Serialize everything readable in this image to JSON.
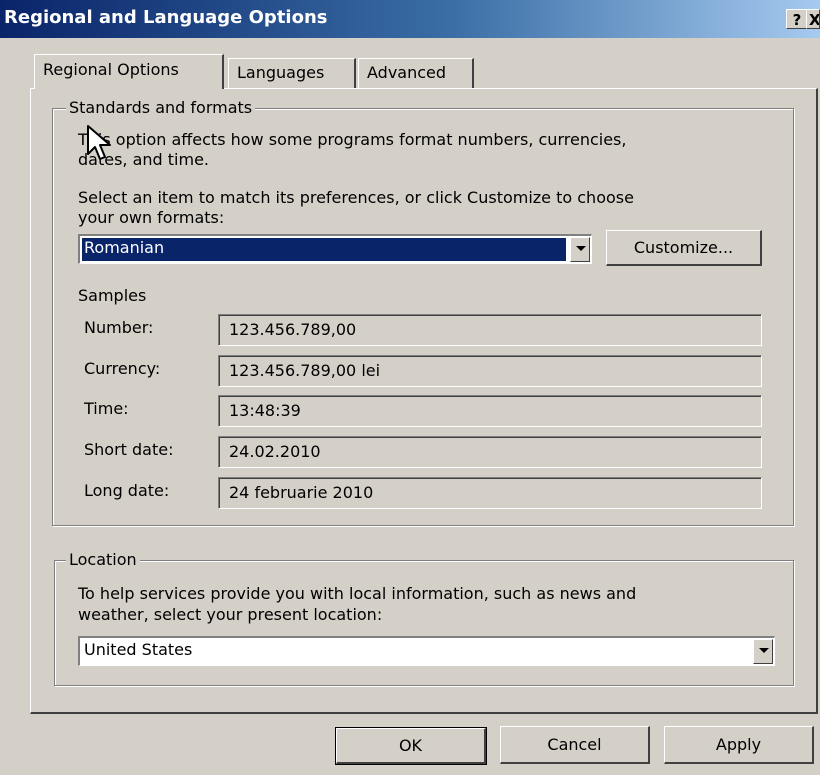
{
  "window": {
    "title": "Regional and Language Options",
    "help_label": "?",
    "close_label": "X"
  },
  "tabs": [
    {
      "label": "Regional Options",
      "active": true
    },
    {
      "label": "Languages",
      "active": false
    },
    {
      "label": "Advanced",
      "active": false
    }
  ],
  "standards": {
    "group_label": "Standards and formats",
    "description_line1": "This option affects how some programs format numbers, currencies,",
    "description_line2": "dates, and time.",
    "instruction_line1": "Select an item to match its preferences, or click Customize to choose",
    "instruction_line2": "your own formats:",
    "format_value": "Romanian",
    "customize_label": "Customize...",
    "samples_label": "Samples",
    "samples": [
      {
        "label": "Number:",
        "value": "123.456.789,00"
      },
      {
        "label": "Currency:",
        "value": "123.456.789,00 lei"
      },
      {
        "label": "Time:",
        "value": "13:48:39"
      },
      {
        "label": "Short date:",
        "value": "24.02.2010"
      },
      {
        "label": "Long date:",
        "value": "24 februarie 2010"
      }
    ]
  },
  "location": {
    "group_label": "Location",
    "description_line1": "To help services provide you with local information, such as news and",
    "description_line2": "weather, select your present location:",
    "value": "United States"
  },
  "buttons": {
    "ok": "OK",
    "cancel": "Cancel",
    "apply": "Apply"
  }
}
